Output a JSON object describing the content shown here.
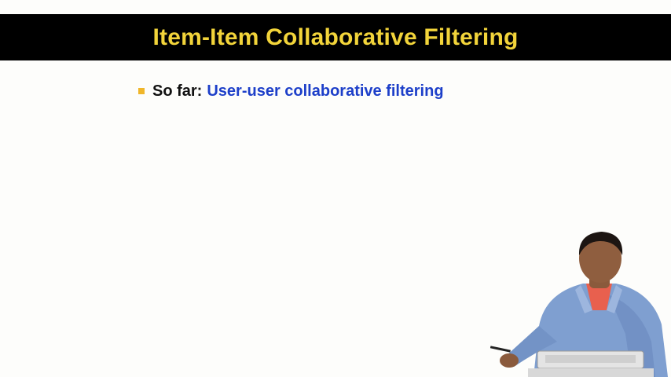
{
  "slide": {
    "title": "Item-Item Collaborative Filtering",
    "bullets": [
      {
        "lead": "So far:",
        "highlight": "User-user collaborative filtering"
      }
    ]
  },
  "colors": {
    "title_bar": "#000000",
    "title_text": "#f2d43a",
    "bullet_marker": "#f0b62a",
    "highlight_text": "#1d3fc9",
    "shirt": "#7f9fd0",
    "undershirt": "#e8604e"
  }
}
